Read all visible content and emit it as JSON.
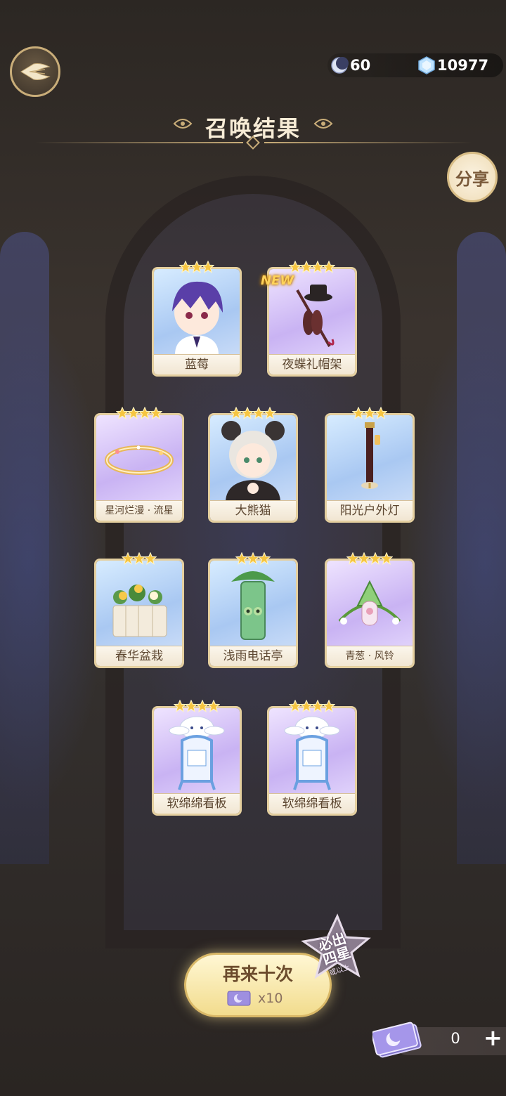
{
  "header": {
    "back_icon": "back-wing-icon",
    "currencies": [
      {
        "icon": "moon-token-icon",
        "value": "60"
      },
      {
        "icon": "crystal-gem-icon",
        "value": "10977"
      }
    ]
  },
  "title": "召唤结果",
  "share_label": "分享",
  "cards": [
    {
      "name": "蓝莓",
      "stars": 3,
      "bg": "blue",
      "is_new": false,
      "art": "purple-haired-boy-character"
    },
    {
      "name": "夜蝶礼帽架",
      "stars": 4,
      "bg": "purple",
      "is_new": true,
      "art": "hat-stand-furniture"
    },
    {
      "name": "星河烂漫 · 流星",
      "stars": 4,
      "bg": "purple",
      "is_new": false,
      "art": "golden-starry-ring"
    },
    {
      "name": "大熊猫",
      "stars": 4,
      "bg": "blue",
      "is_new": false,
      "art": "panda-hood-character"
    },
    {
      "name": "阳光户外灯",
      "stars": 3,
      "bg": "blue",
      "is_new": false,
      "art": "outdoor-lamp-post"
    },
    {
      "name": "春华盆栽",
      "stars": 3,
      "bg": "blue",
      "is_new": false,
      "art": "flower-planter-box"
    },
    {
      "name": "浅雨电话亭",
      "stars": 3,
      "bg": "blue",
      "is_new": false,
      "art": "frog-phone-booth"
    },
    {
      "name": "青葱 · 风铃",
      "stars": 4,
      "bg": "purple",
      "is_new": false,
      "art": "green-wind-chime"
    },
    {
      "name": "软绵绵看板",
      "stars": 4,
      "bg": "purple",
      "is_new": false,
      "art": "bunny-signboard"
    },
    {
      "name": "软绵绵看板",
      "stars": 4,
      "bg": "purple",
      "is_new": false,
      "art": "bunny-signboard"
    }
  ],
  "new_badge": "NEW",
  "summon_again": {
    "label": "再来十次",
    "cost": "x10",
    "cost_icon": "summon-ticket-icon"
  },
  "guarantee": {
    "text_line1": "必出",
    "text_line2": "四星",
    "text_small": "或以上"
  },
  "tickets": {
    "icon": "summon-ticket-icon",
    "count": "0",
    "plus": "+"
  },
  "colors": {
    "gold": "#c9ad79",
    "card_border": "#e4cf9f",
    "star": "#f5c542",
    "button_top": "#fff7d4"
  }
}
